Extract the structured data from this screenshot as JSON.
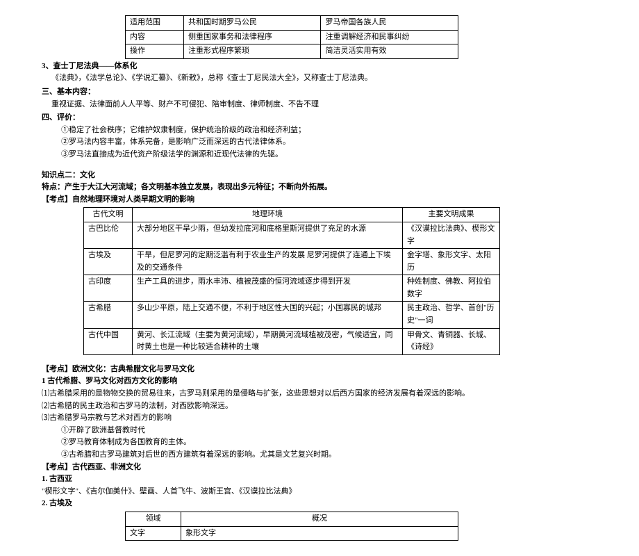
{
  "table1": {
    "rows": [
      [
        "适用范围",
        "共和国时期罗马公民",
        "罗马帝国各族人民"
      ],
      [
        "内容",
        "侧重国家事务和法律程序",
        "注重调解经济和民事纠纷"
      ],
      [
        "操作",
        "注重形式程序繁琐",
        "简洁灵活实用有效"
      ]
    ]
  },
  "s3": {
    "title": "3、查士丁尼法典——体系化",
    "line": "《法典》，《法学总论》、《学说汇纂》、《新敕》，总称《查士丁尼民法大全》，又称查士丁尼法典。"
  },
  "san": {
    "title": "三、基本内容：",
    "line": "重视证据、法律面前人人平等、财产不可侵犯、陪审制度、律师制度、不告不理"
  },
  "si": {
    "title": "四、评价：",
    "l1": "①稳定了社会秩序；它维护奴隶制度，保护统治阶级的政治和经济利益；",
    "l2": "②罗马法内容丰富，体系完备，是影响广泛而深远的古代法律体系。",
    "l3": "③罗马法直接成为近代资产阶级法学的渊源和近现代法律的先驱。"
  },
  "kp2": {
    "title": "知识点二：文化",
    "feature": "特点：产生于大江大河流域；各文明基本独立发展，表现出多元特征；不断向外拓展。",
    "kd1": "【考点】自然地理环境对人类早期文明的影响"
  },
  "table2": {
    "header": [
      "古代文明",
      "地理环境",
      "主要文明成果"
    ],
    "rows": [
      [
        "古巴比伦",
        "大部分地区干旱少雨，但幼发拉底河和底格里斯河提供了充足的水源",
        "《汉谟拉比法典》、楔形文字"
      ],
      [
        "古埃及",
        "干旱，但尼罗河的定期泛滥有利于农业生产的发展 尼罗河提供了连通上下埃及的交通条件",
        "金字塔、象形文字、太阳历"
      ],
      [
        "古印度",
        "生产工具的进步，雨水丰沛、植被茂盛的恒河流域逐步得到开发",
        "种姓制度、佛教、阿拉伯数字"
      ],
      [
        "古希腊",
        "多山少平原，陆上交通不便，不利于地区性大国的兴起；小国寡民的城邦",
        "民主政治、哲学、首创\"历史\"一词"
      ],
      [
        "古代中国",
        "黄河、长江流域（主要为黄河流域），早期黄河流域植被茂密，气候适宜，同时黄土也是一种比较适合耕种的土壤",
        "甲骨文、青铜器、长城、《诗经》"
      ]
    ]
  },
  "euro": {
    "kd": "【考点】欧洲文化：古典希腊文化与罗马文化",
    "h1": "1 古代希腊、罗马文化对西方文化的影响",
    "l1": "⑴古希腊采用的是物物交换的贸易往来，古罗马则采用的是侵略与扩张，这些思想对以后西方国家的经济发展有着深远的影响。",
    "l2": "⑵古希腊的民主政治和古罗马的法制，对西欧影响深远。",
    "l3": "⑶古希腊罗马宗教与艺术对西方的影响",
    "l31": "①开辟了欧洲基督教时代",
    "l32": "②罗马教育体制成为各国教育的主体。",
    "l33": "③古希腊和古罗马建筑对后世的西方建筑有着深远的影响。尤其是文艺复兴时期。"
  },
  "asia": {
    "kd": "【考点】古代西亚、非洲文化",
    "h1": "1. 古西亚",
    "l1": "\"楔形文字\"、《吉尔伽美什》、壁画、人首飞牛、波斯王宫、《汉谟拉比法典》",
    "h2": "2. 古埃及"
  },
  "table3": {
    "header": [
      "领域",
      "概况"
    ],
    "rows": [
      [
        "文字",
        "象形文字"
      ]
    ]
  }
}
